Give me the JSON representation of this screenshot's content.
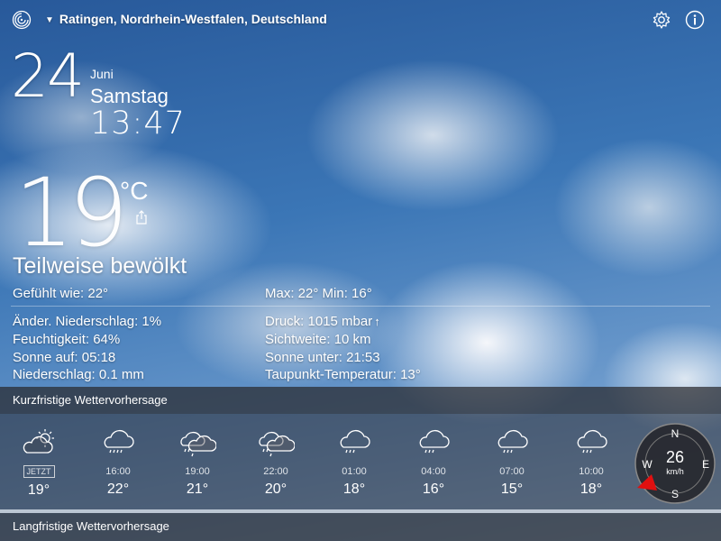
{
  "header": {
    "location": "Ratingen, Nordrhein-Westfalen, Deutschland",
    "icons": [
      "app-logo-icon",
      "caret-down-icon",
      "gear-icon",
      "info-icon"
    ]
  },
  "date": {
    "day": "24",
    "month": "Juni",
    "weekday": "Samstag",
    "time": "13:47"
  },
  "current": {
    "temp": "19",
    "unit": "°C",
    "condition": "Teilweise bewölkt",
    "feels_like": "Gefühlt wie: 22°",
    "max_min": "Max: 22°  Min: 16°",
    "left_details": [
      "Änder. Niederschlag: 1%",
      "Feuchtigkeit: 64%",
      "Sonne auf: 05:18",
      "Niederschlag: 0.1 mm"
    ],
    "right_details": [
      "Druck: 1015 mbar",
      "Sichtweite: 10 km",
      "Sonne unter: 21:53",
      "Taupunkt-Temperatur: 13°"
    ],
    "pressure_trend": "↑"
  },
  "short_term": {
    "title": "Kurzfristige Wettervorhersage",
    "items": [
      {
        "time": "JETZT",
        "temp": "19°",
        "icon": "partly-sunny-icon"
      },
      {
        "time": "16:00",
        "temp": "22°",
        "icon": "rain-cloud-icon"
      },
      {
        "time": "19:00",
        "temp": "21°",
        "icon": "rain-clouds-icon"
      },
      {
        "time": "22:00",
        "temp": "20°",
        "icon": "rain-clouds-icon"
      },
      {
        "time": "01:00",
        "temp": "18°",
        "icon": "rain-cloud-icon"
      },
      {
        "time": "04:00",
        "temp": "16°",
        "icon": "rain-cloud-icon"
      },
      {
        "time": "07:00",
        "temp": "15°",
        "icon": "rain-cloud-icon"
      },
      {
        "time": "10:00",
        "temp": "18°",
        "icon": "rain-cloud-icon"
      }
    ]
  },
  "wind": {
    "speed": "26",
    "unit": "km/h",
    "directions": {
      "n": "N",
      "e": "E",
      "s": "S",
      "w": "W"
    },
    "pointer_color": "#e01010"
  },
  "long_term": {
    "title": "Langfristige Wettervorhersage"
  }
}
